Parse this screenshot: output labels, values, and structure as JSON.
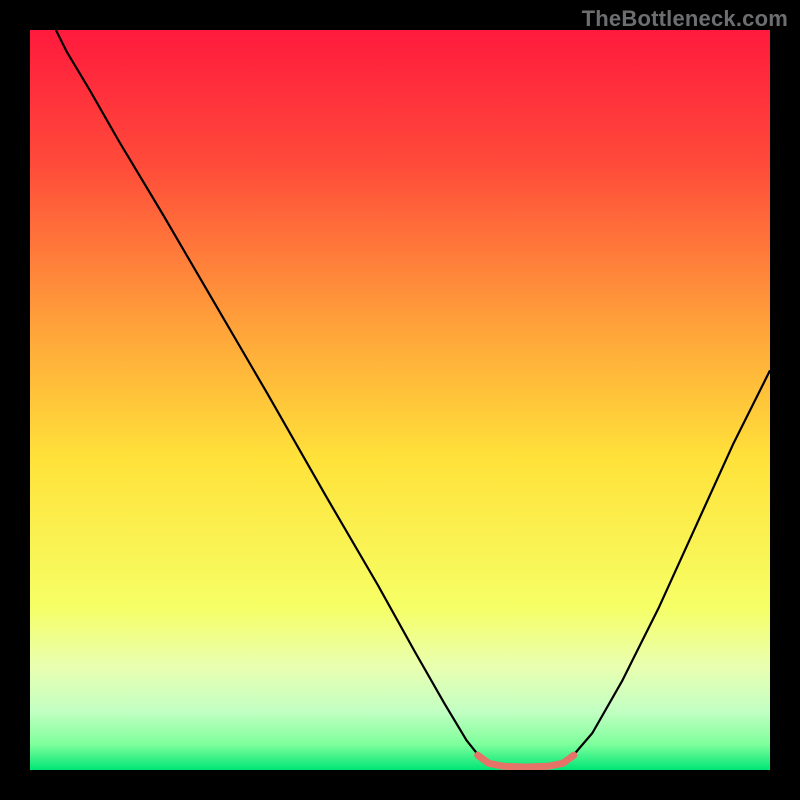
{
  "watermark": "TheBottleneck.com",
  "chart_data": {
    "type": "line",
    "title": "",
    "xlabel": "",
    "ylabel": "",
    "xlim": [
      0,
      100
    ],
    "ylim": [
      0,
      100
    ],
    "background_gradient": {
      "stops": [
        {
          "pos": 0,
          "color": "#ff1a3d"
        },
        {
          "pos": 0.18,
          "color": "#ff4a3a"
        },
        {
          "pos": 0.4,
          "color": "#ffa23a"
        },
        {
          "pos": 0.58,
          "color": "#ffe23a"
        },
        {
          "pos": 0.78,
          "color": "#f6ff66"
        },
        {
          "pos": 0.86,
          "color": "#e9ffb0"
        },
        {
          "pos": 0.92,
          "color": "#c3ffc3"
        },
        {
          "pos": 0.965,
          "color": "#7fff9c"
        },
        {
          "pos": 1.0,
          "color": "#00e676"
        }
      ]
    },
    "series": [
      {
        "name": "bottleneck-curve",
        "color": "#000000",
        "width": 2.2,
        "points": [
          {
            "x": 3.5,
            "y": 100
          },
          {
            "x": 5,
            "y": 97
          },
          {
            "x": 8,
            "y": 92
          },
          {
            "x": 12,
            "y": 85
          },
          {
            "x": 18,
            "y": 75
          },
          {
            "x": 25,
            "y": 63
          },
          {
            "x": 32,
            "y": 51
          },
          {
            "x": 40,
            "y": 37
          },
          {
            "x": 47,
            "y": 25
          },
          {
            "x": 52,
            "y": 16
          },
          {
            "x": 56,
            "y": 9
          },
          {
            "x": 59,
            "y": 4
          },
          {
            "x": 61,
            "y": 1.5
          },
          {
            "x": 63,
            "y": 0.6
          },
          {
            "x": 67,
            "y": 0.4
          },
          {
            "x": 71,
            "y": 0.6
          },
          {
            "x": 73,
            "y": 1.5
          },
          {
            "x": 76,
            "y": 5
          },
          {
            "x": 80,
            "y": 12
          },
          {
            "x": 85,
            "y": 22
          },
          {
            "x": 90,
            "y": 33
          },
          {
            "x": 95,
            "y": 44
          },
          {
            "x": 100,
            "y": 54
          }
        ]
      },
      {
        "name": "optimal-zone-marker",
        "color": "#e57368",
        "width": 7,
        "linecap": "round",
        "points": [
          {
            "x": 60.5,
            "y": 2.0
          },
          {
            "x": 62,
            "y": 0.9
          },
          {
            "x": 64,
            "y": 0.5
          },
          {
            "x": 67,
            "y": 0.4
          },
          {
            "x": 70,
            "y": 0.5
          },
          {
            "x": 72,
            "y": 0.9
          },
          {
            "x": 73.5,
            "y": 2.0
          }
        ]
      }
    ]
  }
}
